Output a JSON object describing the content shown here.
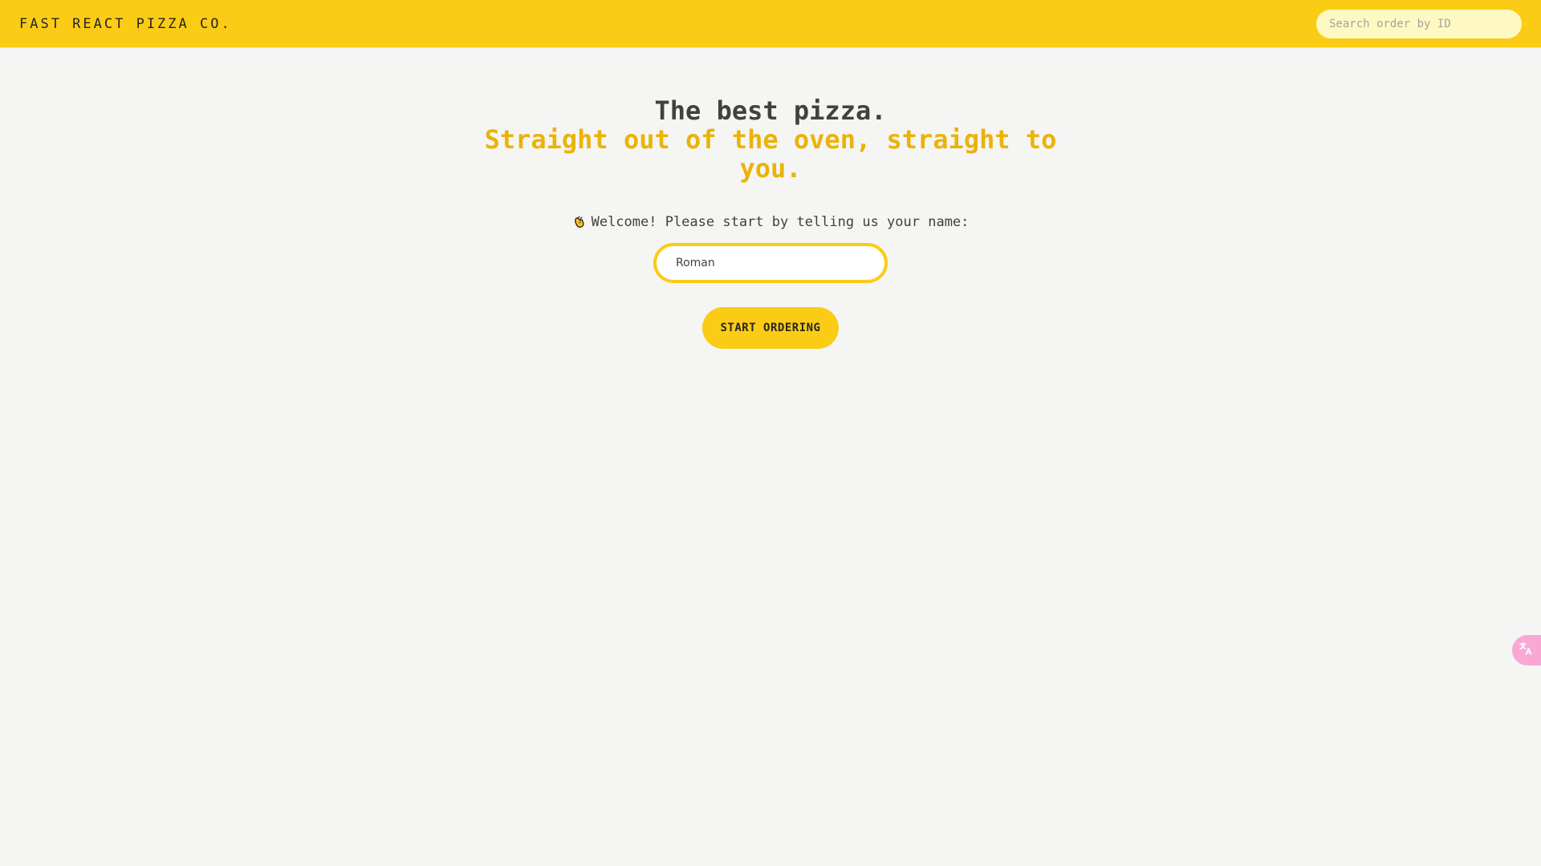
{
  "header": {
    "logo": "Fast React Pizza Co.",
    "search_placeholder": "Search order by ID",
    "background_color": "#facc15"
  },
  "hero": {
    "title": "The best pizza.",
    "subtitle": "Straight out of the oven, straight to you."
  },
  "form": {
    "prompt": "Welcome! Please start by telling us your name:",
    "prompt_icon": "clapping-hands-icon",
    "name_value": "Roman",
    "submit_label": "Start ordering",
    "accent_color": "#facc15"
  },
  "translate_widget": {
    "icon": "translate-icon",
    "color": "#f9a8d4"
  }
}
